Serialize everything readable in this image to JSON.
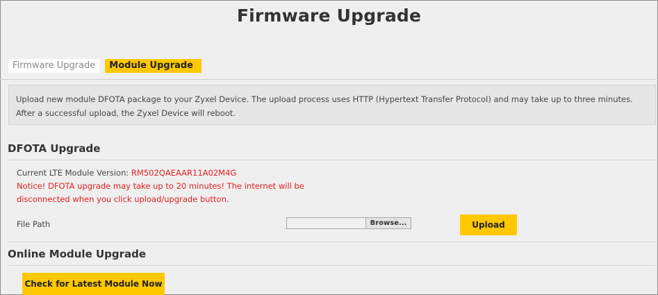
{
  "page": {
    "title": "Firmware Upgrade"
  },
  "tabs": [
    {
      "label": "Firmware Upgrade",
      "active": false
    },
    {
      "label": "Module Upgrade",
      "active": true
    }
  ],
  "description": "Upload new module DFOTA package to your Zyxel Device. The upload process uses HTTP (Hypertext Transfer Protocol) and may take up to three minutes. After a successful upload, the Zyxel Device will reboot.",
  "dfota": {
    "title": "DFOTA Upgrade",
    "version_label": "Current LTE Module Version: ",
    "version_value": "RM502QAEAAR11A02M4G",
    "notice": "Notice! DFOTA upgrade may take up to 20 minutes! The internet will be disconnected when you click upload/upgrade button.",
    "file_path_label": "File Path",
    "file_path_value": "",
    "browse_label": "Browse...",
    "upload_label": "Upload"
  },
  "online": {
    "title": "Online Module Upgrade",
    "check_label": "Check for Latest Module Now"
  },
  "colors": {
    "accent": "#ffc800",
    "notice_red": "#e22020",
    "background": "#efefef"
  }
}
